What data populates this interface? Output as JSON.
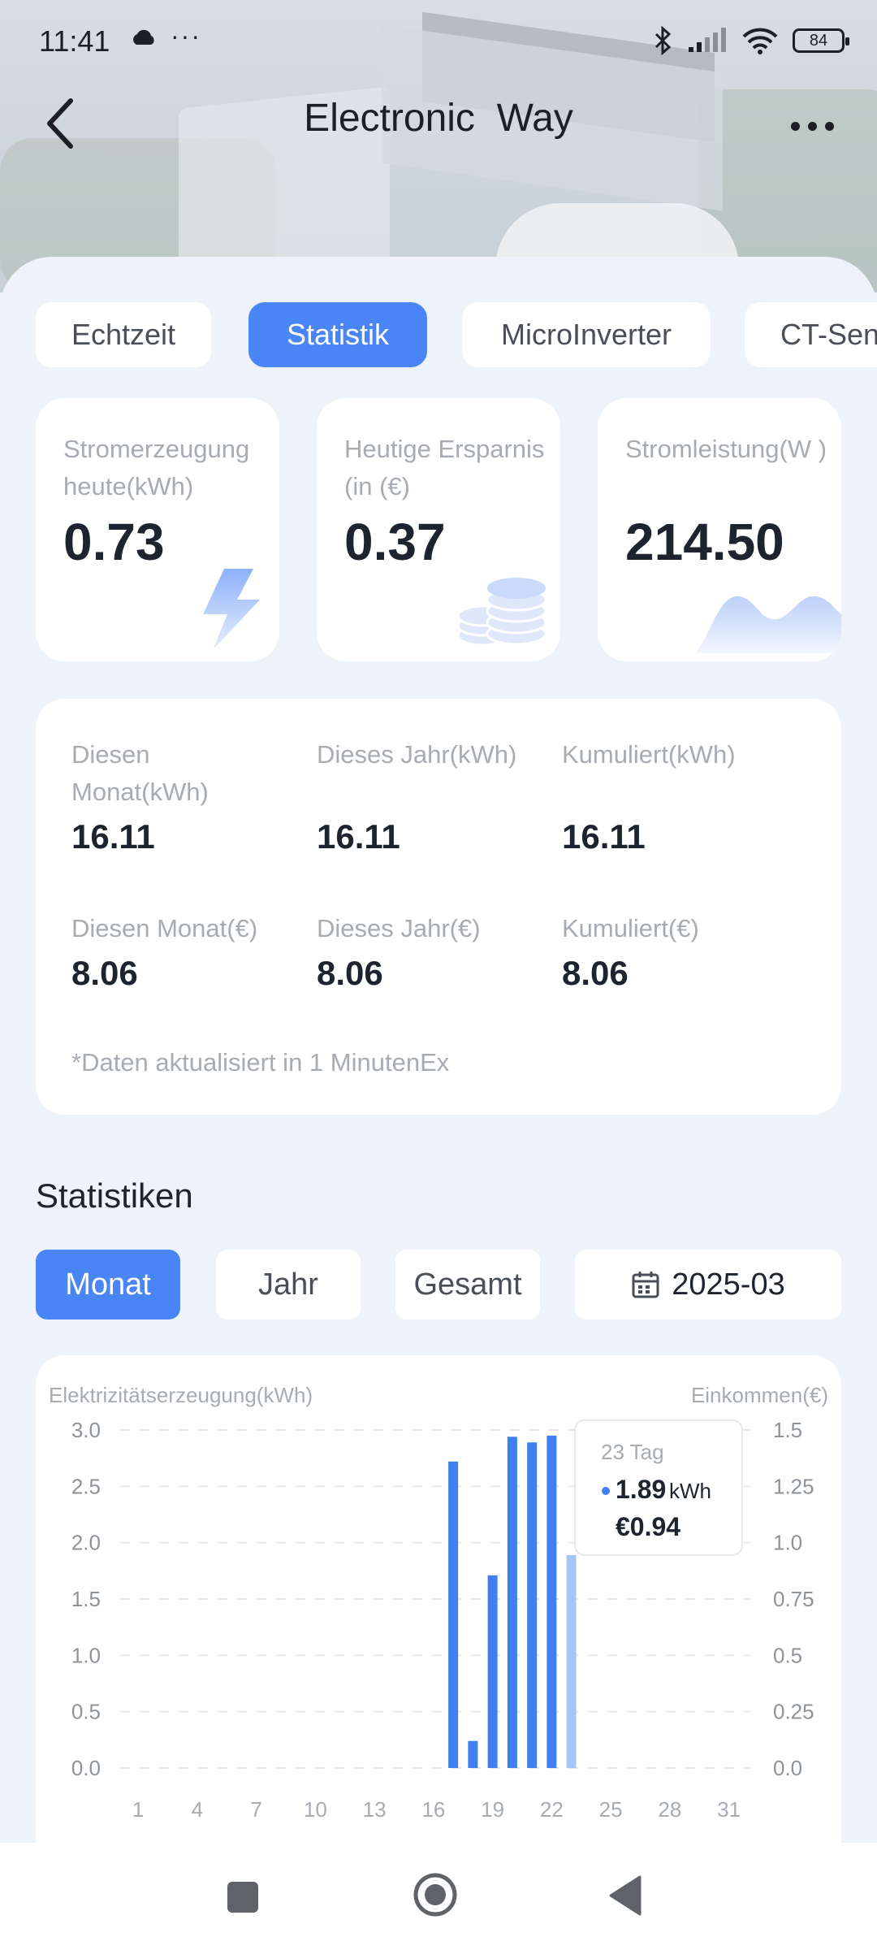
{
  "status_bar": {
    "time": "11:41",
    "battery": "84"
  },
  "header": {
    "title": "Electronic  Way"
  },
  "tabs": [
    {
      "label": "Echtzeit",
      "active": false
    },
    {
      "label": "Statistik",
      "active": true
    },
    {
      "label": "MicroInverter",
      "active": false
    },
    {
      "label": "CT-Sensor",
      "active": false
    }
  ],
  "cards": [
    {
      "label": "Stromerzeugung heute(kWh)",
      "value": "0.73",
      "icon": "lightning-icon"
    },
    {
      "label": "Heutige Ersparnis (in (€)",
      "value": "0.37",
      "icon": "coins-icon"
    },
    {
      "label": "Stromleistung(W )",
      "value": "214.50",
      "icon": "area-wave-icon"
    }
  ],
  "summary": {
    "items": [
      {
        "label": "Diesen Monat(kWh)",
        "value": "16.11"
      },
      {
        "label": "Dieses Jahr(kWh)",
        "value": "16.11"
      },
      {
        "label": "Kumuliert(kWh)",
        "value": "16.11"
      },
      {
        "label": "Diesen Monat(€)",
        "value": "8.06"
      },
      {
        "label": "Dieses Jahr(€)",
        "value": "8.06"
      },
      {
        "label": "Kumuliert(€)",
        "value": "8.06"
      }
    ],
    "note": "*Daten aktualisiert in 1 MinutenEx"
  },
  "statistics": {
    "title": "Statistiken",
    "periods": [
      {
        "label": "Monat",
        "active": true
      },
      {
        "label": "Jahr",
        "active": false
      },
      {
        "label": "Gesamt",
        "active": false
      }
    ],
    "date": "2025-03"
  },
  "colors": {
    "accent": "#4a85f6",
    "bar": "#3f7ff2",
    "bar_selected": "#a9c3f7"
  },
  "chart_data": {
    "type": "bar",
    "title": "",
    "ylabel_left": "Elektrizitätserzeugung(kWh)",
    "ylabel_right": "Einkommen(€)",
    "ylim": [
      0,
      3.0
    ],
    "ylim_right": [
      0,
      1.5
    ],
    "y_ticks": [
      "0.0",
      "0.5",
      "1.0",
      "1.5",
      "2.0",
      "2.5",
      "3.0"
    ],
    "y_ticks_right": [
      "0.0",
      "0.25",
      "0.5",
      "0.75",
      "1.0",
      "1.25",
      "1.5"
    ],
    "x_ticks": [
      "1",
      "4",
      "7",
      "10",
      "13",
      "16",
      "19",
      "22",
      "25",
      "28",
      "31"
    ],
    "x": [
      17,
      18,
      19,
      20,
      21,
      22,
      23
    ],
    "values": [
      2.72,
      0.24,
      1.71,
      2.94,
      2.89,
      2.95,
      1.89
    ],
    "selected_day": 23,
    "grid": true,
    "tooltip": {
      "day": "23 Tag",
      "kwh": "1.89",
      "unit": "kWh",
      "income": "€0.94"
    }
  }
}
